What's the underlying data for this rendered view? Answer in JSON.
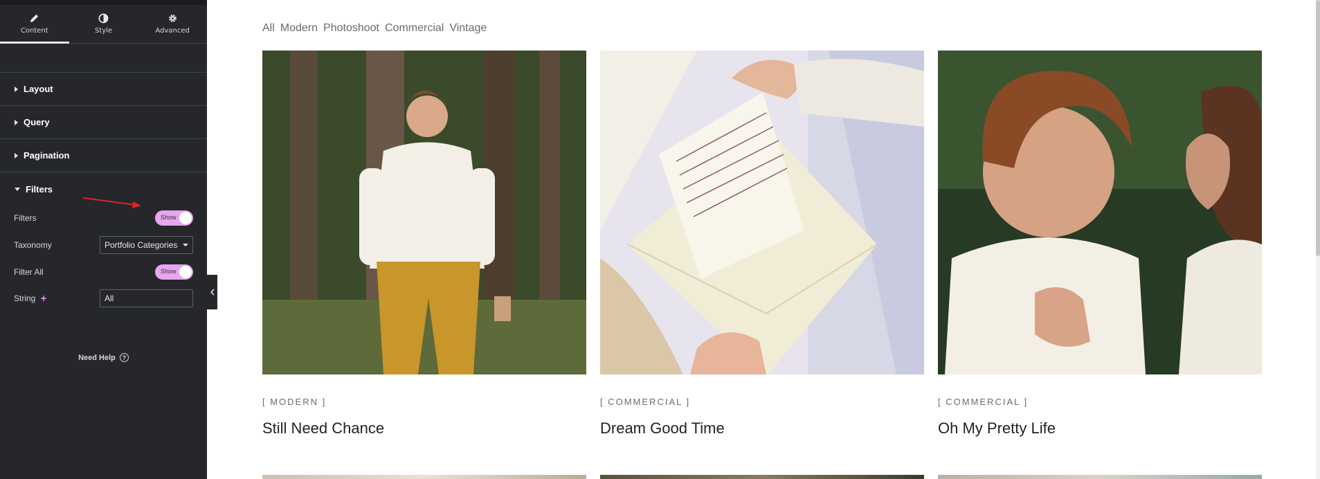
{
  "panel": {
    "tabs": [
      {
        "label": "Content",
        "icon": "pencil-icon"
      },
      {
        "label": "Style",
        "icon": "contrast-icon"
      },
      {
        "label": "Advanced",
        "icon": "gear-icon"
      }
    ],
    "sections": [
      {
        "label": "Layout"
      },
      {
        "label": "Query"
      },
      {
        "label": "Pagination"
      },
      {
        "label": "Filters"
      }
    ],
    "controls": {
      "filters_label": "Filters",
      "filters_toggle": "Show",
      "taxonomy_label": "Taxonomy",
      "taxonomy_value": "Portfolio Categories",
      "filter_all_label": "Filter All",
      "filter_all_toggle": "Show",
      "string_label": "String",
      "string_value": "All"
    },
    "help_label": "Need Help",
    "accent_color": "#e7a6f0"
  },
  "content": {
    "filters": [
      "All",
      "Modern",
      "Photoshoot",
      "Commercial",
      "Vintage"
    ],
    "cards": [
      {
        "category": "[ MODERN ]",
        "title": "Still Need Chance"
      },
      {
        "category": "[ COMMERCIAL ]",
        "title": "Dream Good Time"
      },
      {
        "category": "[ COMMERCIAL ]",
        "title": "Oh My Pretty Life"
      }
    ]
  }
}
